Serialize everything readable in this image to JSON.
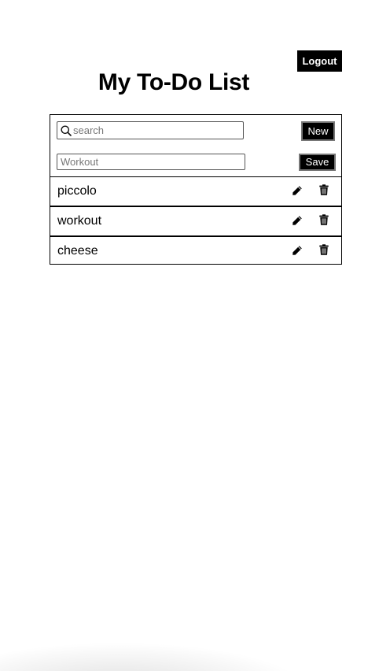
{
  "header": {
    "logout_label": "Logout",
    "title": "My To-Do List"
  },
  "search": {
    "placeholder": "search",
    "value": ""
  },
  "toolbar": {
    "new_label": "New",
    "save_label": "Save"
  },
  "task_input": {
    "placeholder": "Workout",
    "value": ""
  },
  "todos": [
    {
      "label": "piccolo",
      "edit_icon": "pencil-icon",
      "delete_icon": "trash-icon"
    },
    {
      "label": "workout",
      "edit_icon": "pencil-icon",
      "delete_icon": "trash-icon"
    },
    {
      "label": "cheese",
      "edit_icon": "pencil-icon",
      "delete_icon": "trash-icon"
    }
  ],
  "colors": {
    "background": "#ffffff",
    "button_bg": "#000000",
    "button_text": "#ffffff",
    "border": "#000000"
  }
}
